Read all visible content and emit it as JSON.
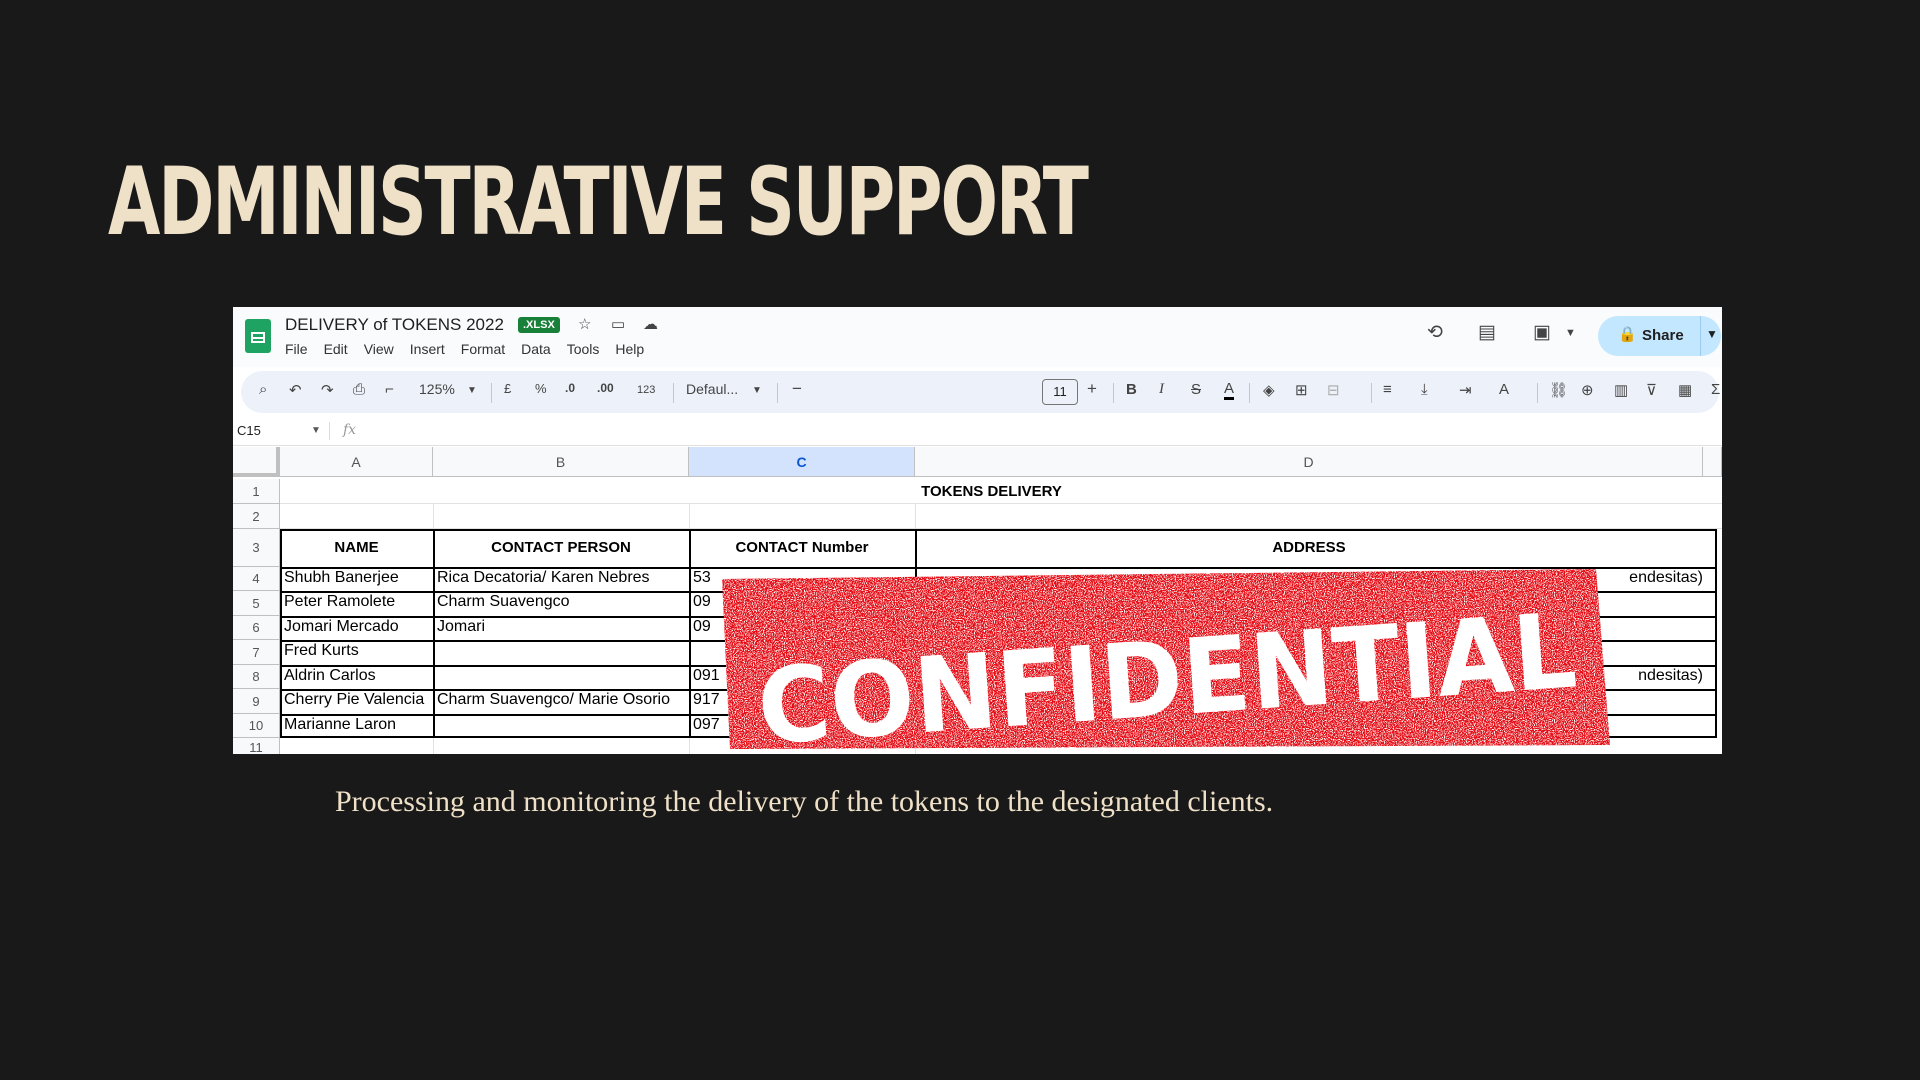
{
  "slide": {
    "title": "ADMINISTRATIVE SUPPORT",
    "caption": "Processing and monitoring the delivery of the tokens to the designated clients."
  },
  "app": {
    "doc_title": "DELIVERY of TOKENS 2022",
    "file_badge": ".XLSX",
    "menu": [
      "File",
      "Edit",
      "View",
      "Insert",
      "Format",
      "Data",
      "Tools",
      "Help"
    ],
    "share_label": "Share"
  },
  "toolbar": {
    "zoom": "125%",
    "currency": "£",
    "percent": "%",
    "decrease_decimal": ".0",
    "increase_decimal": ".00",
    "number_format": "123",
    "font": "Defaul...",
    "font_size": "11",
    "bold": "B",
    "italic": "I",
    "strike": "S",
    "text_color": "A",
    "functions": "Σ"
  },
  "formula_bar": {
    "name_box": "C15",
    "fx": "fx"
  },
  "sheet": {
    "columns": [
      "A",
      "B",
      "C",
      "D"
    ],
    "selected_column": "C",
    "rows": [
      "1",
      "2",
      "3",
      "4",
      "5",
      "6",
      "7",
      "8",
      "9",
      "10",
      "11"
    ],
    "table_title": "TOKENS DELIVERY",
    "headers": [
      "NAME",
      "CONTACT PERSON",
      "CONTACT Number",
      "ADDRESS"
    ],
    "data": [
      {
        "name": "Shubh Banerjee",
        "contact_person": "Rica Decatoria/ Karen Nebres",
        "contact_number": "53",
        "address": "endesitas)"
      },
      {
        "name": "Peter Ramolete",
        "contact_person": "Charm Suavengco",
        "contact_number": "09",
        "address": ""
      },
      {
        "name": "Jomari Mercado",
        "contact_person": "Jomari",
        "contact_number": "09",
        "address": ""
      },
      {
        "name": "Fred Kurts",
        "contact_person": "",
        "contact_number": "",
        "address": ""
      },
      {
        "name": "Aldrin Carlos",
        "contact_person": "",
        "contact_number": "091",
        "address": "ndesitas)"
      },
      {
        "name": "Cherry Pie Valencia",
        "contact_person": "Charm Suavengco/ Marie Osorio",
        "contact_number": "917",
        "address": ""
      },
      {
        "name": "Marianne Laron",
        "contact_person": "",
        "contact_number": "097",
        "address": ""
      }
    ]
  },
  "stamp": {
    "text": "CONFIDENTIAL",
    "color": "#e60a14"
  },
  "colors": {
    "background": "#1a1919",
    "title": "#efe1c8",
    "sheets_green": "#1ea362",
    "share_bg": "#c2e7ff"
  }
}
